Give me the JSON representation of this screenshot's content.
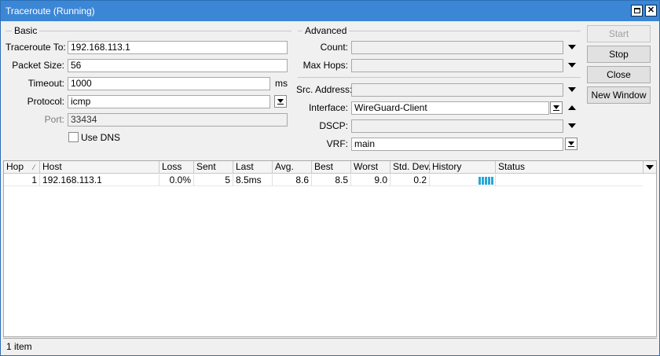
{
  "window": {
    "title": "Traceroute (Running)"
  },
  "basic": {
    "group_label": "Basic",
    "traceroute_to": {
      "label": "Traceroute To:",
      "value": "192.168.113.1"
    },
    "packet_size": {
      "label": "Packet Size:",
      "value": "56"
    },
    "timeout": {
      "label": "Timeout:",
      "value": "1000",
      "unit": "ms"
    },
    "protocol": {
      "label": "Protocol:",
      "value": "icmp"
    },
    "port": {
      "label": "Port:",
      "value": "33434"
    },
    "use_dns": {
      "label": "Use DNS",
      "checked": false
    }
  },
  "advanced": {
    "group_label": "Advanced",
    "count": {
      "label": "Count:",
      "value": ""
    },
    "max_hops": {
      "label": "Max Hops:",
      "value": ""
    },
    "src_address": {
      "label": "Src. Address:",
      "value": ""
    },
    "interface": {
      "label": "Interface:",
      "value": "WireGuard-Client"
    },
    "dscp": {
      "label": "DSCP:",
      "value": ""
    },
    "vrf": {
      "label": "VRF:",
      "value": "main"
    }
  },
  "buttons": {
    "start": "Start",
    "stop": "Stop",
    "close": "Close",
    "new_window": "New Window"
  },
  "table": {
    "columns": [
      "Hop",
      "Host",
      "Loss",
      "Sent",
      "Last",
      "Avg.",
      "Best",
      "Worst",
      "Std. Dev.",
      "History",
      "Status"
    ],
    "rows": [
      {
        "hop": "1",
        "host": "192.168.113.1",
        "loss": "0.0%",
        "sent": "5",
        "last": "8.5ms",
        "avg": "8.6",
        "best": "8.5",
        "worst": "9.0",
        "std_dev": "0.2",
        "history_bars": 5,
        "status": ""
      }
    ]
  },
  "status": {
    "text": "1 item"
  },
  "colors": {
    "titlebar": "#3c86d6",
    "history_bar": "#2aa6d9"
  }
}
